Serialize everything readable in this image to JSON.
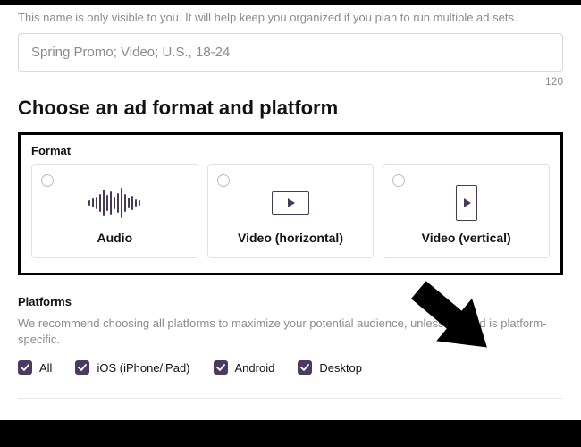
{
  "name_helper": "This name is only visible to you. It will help keep you organized if you plan to run multiple ad sets.",
  "name_input": {
    "value": "Spring Promo; Video; U.S., 18-24",
    "counter": "120"
  },
  "heading": "Choose an ad format and platform",
  "format": {
    "section_title": "Format",
    "options": {
      "audio": "Audio",
      "video_h": "Video (horizontal)",
      "video_v": "Video (vertical)"
    }
  },
  "platforms": {
    "section_title": "Platforms",
    "description": "We recommend choosing all platforms to maximize your potential audience, unless your ad is platform-specific.",
    "items": {
      "all": "All",
      "ios": "iOS (iPhone/iPad)",
      "android": "Android",
      "desktop": "Desktop"
    }
  },
  "colors": {
    "accent": "#4b3a63"
  }
}
